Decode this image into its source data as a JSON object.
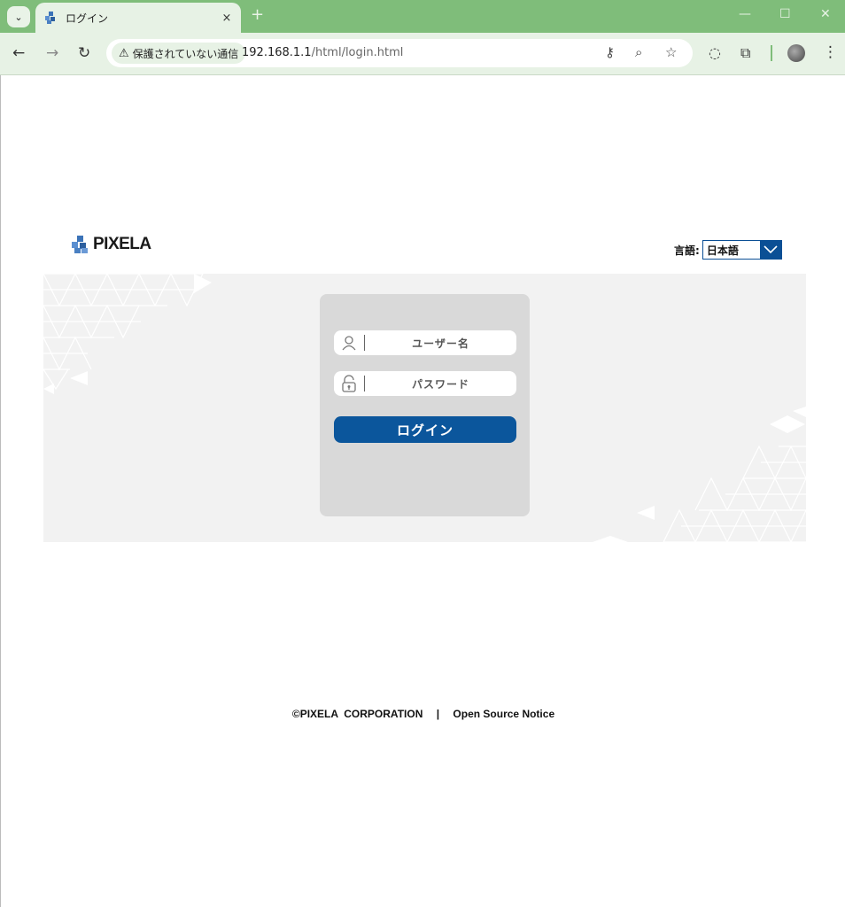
{
  "browser": {
    "tab_title": "ログイン",
    "tab_close": "×",
    "new_tab": "+",
    "security_chip": "保護されていない通信",
    "url_host": "192.168.1.1",
    "url_path": "/html/login.html"
  },
  "page": {
    "brand": "PIXELA",
    "language_label": "言語:",
    "language_value": "日本語",
    "username_placeholder": "ユーザー名",
    "password_placeholder": "パスワード",
    "login_button": "ログイン",
    "copyright": "©PIXELA  CORPORATION",
    "footer_separator": "|",
    "open_source_link": "Open Source Notice"
  },
  "colors": {
    "chrome_frame": "#7fbd7a",
    "chrome_toolbar": "#e7f2e5",
    "accent_blue": "#0b569c",
    "band_gray": "#f2f2f2",
    "card_gray": "#d9d9d9"
  }
}
